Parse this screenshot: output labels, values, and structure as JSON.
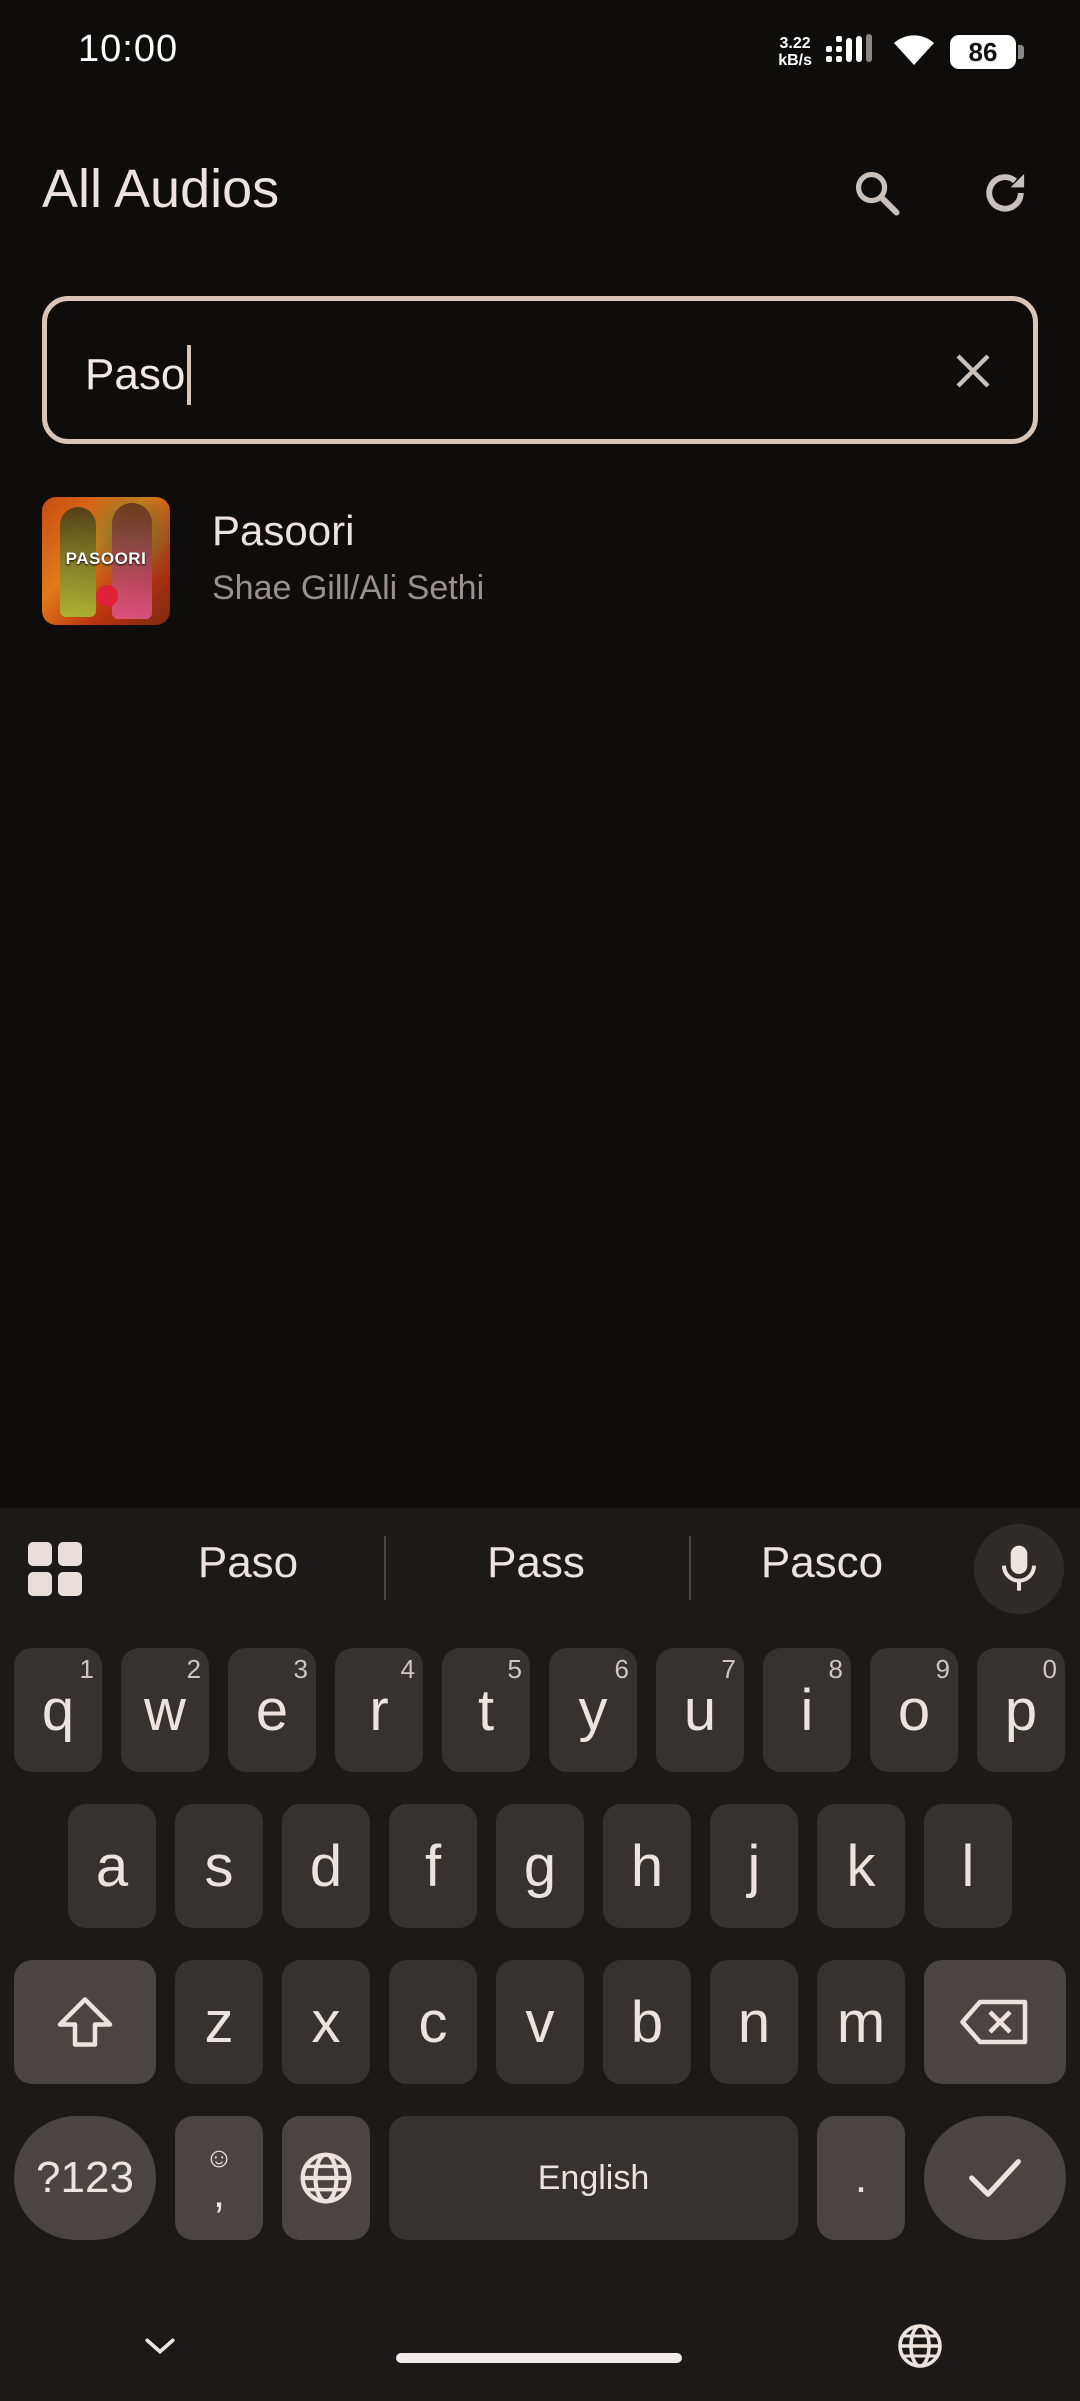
{
  "status_bar": {
    "time": "10:00",
    "net_speed_value": "3.22",
    "net_speed_unit": "kB/s",
    "battery": "86",
    "icons": [
      "signal-icon",
      "wifi-icon",
      "battery-icon"
    ]
  },
  "header": {
    "title": "All Audios",
    "icons": [
      "search-icon",
      "refresh-icon"
    ]
  },
  "search": {
    "value": "Paso",
    "clear_icon": "close-icon"
  },
  "results": [
    {
      "title": "Pasoori",
      "artist": "Shae Gill/Ali Sethi",
      "art_text": "PASOORI"
    }
  ],
  "keyboard": {
    "suggestions": [
      "Paso",
      "Pass",
      "Pasco"
    ],
    "row1": [
      {
        "key": "q",
        "hint": "1"
      },
      {
        "key": "w",
        "hint": "2"
      },
      {
        "key": "e",
        "hint": "3"
      },
      {
        "key": "r",
        "hint": "4"
      },
      {
        "key": "t",
        "hint": "5"
      },
      {
        "key": "y",
        "hint": "6"
      },
      {
        "key": "u",
        "hint": "7"
      },
      {
        "key": "i",
        "hint": "8"
      },
      {
        "key": "o",
        "hint": "9"
      },
      {
        "key": "p",
        "hint": "0"
      }
    ],
    "row2": [
      "a",
      "s",
      "d",
      "f",
      "g",
      "h",
      "j",
      "k",
      "l"
    ],
    "row3": [
      "z",
      "x",
      "c",
      "v",
      "b",
      "n",
      "m"
    ],
    "symbols_label": "?123",
    "comma_label": ",",
    "space_label": "English",
    "period_label": "."
  },
  "colors": {
    "background": "#0f0d0c",
    "accent_border": "#d9c4b8",
    "keyboard_bg": "#1c1a19",
    "key_bg": "#363230"
  }
}
